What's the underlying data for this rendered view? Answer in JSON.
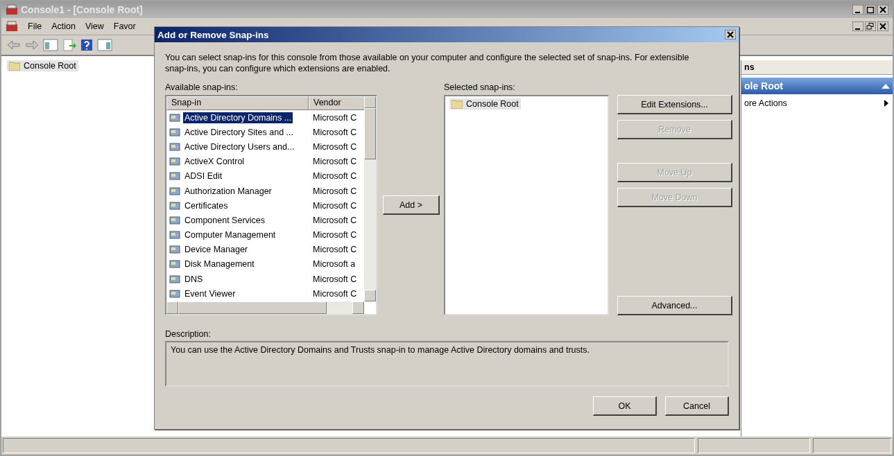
{
  "main_window": {
    "title": "Console1 - [Console Root]",
    "menu": [
      "File",
      "Action",
      "View",
      "Favor"
    ],
    "tree": [
      {
        "label": "Console Root",
        "selected": true
      }
    ],
    "actions_pane": {
      "header": "ns",
      "section": "ole Root",
      "items": [
        "ore Actions"
      ]
    }
  },
  "dialog": {
    "title": "Add or Remove Snap-ins",
    "intro": "You can select snap-ins for this console from those available on your computer and configure the selected set of snap-ins. For extensible snap-ins, you can configure which extensions are enabled.",
    "available_label": "Available snap-ins:",
    "columns": [
      "Snap-in",
      "Vendor"
    ],
    "rows": [
      {
        "name": "Active Directory Domains ...",
        "vendor": "Microsoft C",
        "selected": true
      },
      {
        "name": "Active Directory Sites and ...",
        "vendor": "Microsoft C",
        "selected": false
      },
      {
        "name": "Active Directory Users and...",
        "vendor": "Microsoft C",
        "selected": false
      },
      {
        "name": "ActiveX Control",
        "vendor": "Microsoft C",
        "selected": false
      },
      {
        "name": "ADSI Edit",
        "vendor": "Microsoft C",
        "selected": false
      },
      {
        "name": "Authorization Manager",
        "vendor": "Microsoft C",
        "selected": false
      },
      {
        "name": "Certificates",
        "vendor": "Microsoft C",
        "selected": false
      },
      {
        "name": "Component Services",
        "vendor": "Microsoft C",
        "selected": false
      },
      {
        "name": "Computer Management",
        "vendor": "Microsoft C",
        "selected": false
      },
      {
        "name": "Device Manager",
        "vendor": "Microsoft C",
        "selected": false
      },
      {
        "name": "Disk Management",
        "vendor": "Microsoft a",
        "selected": false
      },
      {
        "name": "DNS",
        "vendor": "Microsoft C",
        "selected": false
      },
      {
        "name": "Event Viewer",
        "vendor": "Microsoft C",
        "selected": false
      }
    ],
    "add_button": "Add >",
    "selected_label": "Selected snap-ins:",
    "selected_items": [
      {
        "label": "Console Root",
        "selected": true
      }
    ],
    "side_buttons": [
      {
        "label": "Edit Extensions...",
        "disabled": false
      },
      {
        "label": "Remove",
        "disabled": true
      },
      {
        "label": "Move Up",
        "disabled": true
      },
      {
        "label": "Move Down",
        "disabled": true
      }
    ],
    "advanced_button": "Advanced...",
    "description_label": "Description:",
    "description": "You can use the Active Directory Domains and Trusts snap-in to manage Active Directory domains and trusts.",
    "buttons": [
      "OK",
      "Cancel"
    ]
  }
}
